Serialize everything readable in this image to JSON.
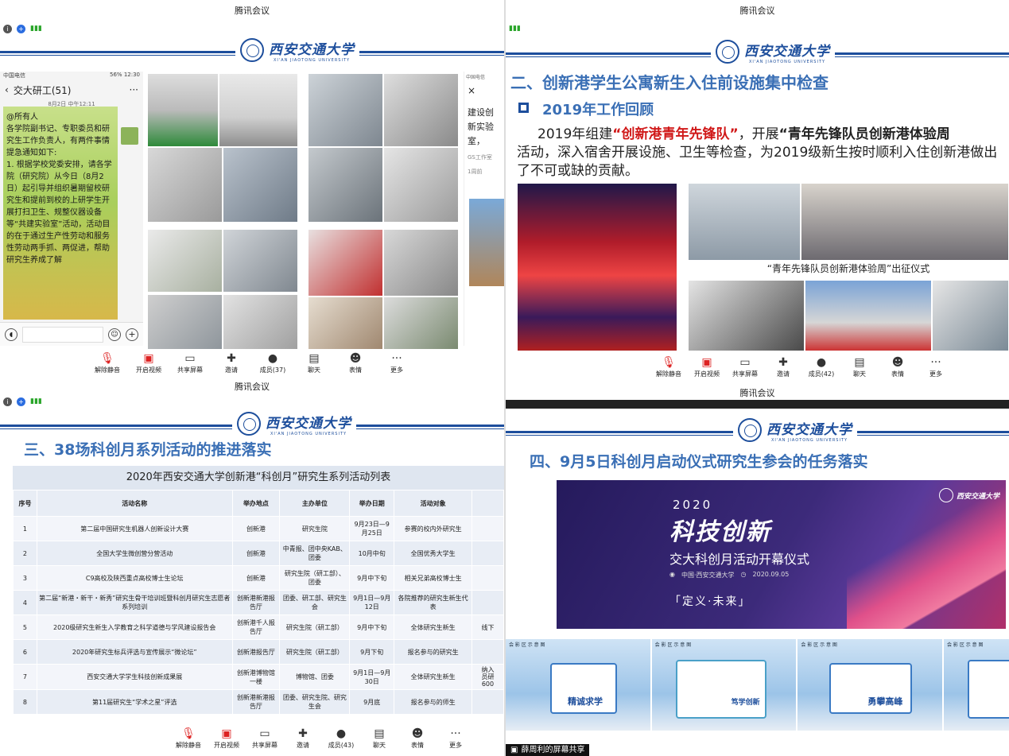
{
  "app_title": "腾讯会议",
  "toolbar": {
    "unmute": "解除静音",
    "video": "开启视频",
    "share": "共享屏幕",
    "invite": "邀请",
    "chat": "聊天",
    "reactions": "表情",
    "more": "更多"
  },
  "p1": {
    "members": "成员(37)"
  },
  "p2": {
    "members": "成员(42)"
  },
  "p3": {
    "members": "成员(43)"
  },
  "university": {
    "cn": "西安交通大学",
    "en": "XI'AN JIAOTONG UNIVERSITY"
  },
  "chat": {
    "status_carrier": "中国电信",
    "status_battery": "56%",
    "status_time": "12:30",
    "title": "交大研工(51)",
    "timestamp": "8月2日 中午12:11",
    "message": "@所有人\n各学院副书记、专职委员和研究生工作负责人，有两件事情提急通知如下:\n1. 根据学校党委安排，请各学院（研究院）从今日（8月2日）起引导并组织暑期留校研究生和提前到校的上研学生开展打扫卫生、规整仪器设备等“共建实验室”活动，活动目的在于通过生产性劳动和服务性劳动两手抓、两促进，帮助研究生养成了解",
    "side_carrier": "中国电信",
    "side_title": "建设创新实验室，",
    "side_source": "GS工作室",
    "side_time": "1周前"
  },
  "p2_slide": {
    "heading": "二、创新港学生公寓新生入住前设施集中检查",
    "subheading": "2019年工作回顾",
    "body_pre": "2019年组建",
    "body_red": "“创新港青年先锋队”",
    "body_mid": "，开展",
    "body_bold": "“青年先锋队员创新港体验周",
    "body_rest": "活动，深入宿舍开展设施、卫生等检查，为2019级新生按时顺利入住创新港做出了不可或缺的贡献。",
    "photo_caption": "“青年先锋队员创新港体验周”出征仪式"
  },
  "p3_slide": {
    "heading": "三、38场科创月系列活动的推进落实",
    "table_title": "2020年西安交通大学创新港“科创月”研究生系列活动列表",
    "columns": [
      "序号",
      "活动名称",
      "举办地点",
      "主办单位",
      "举办日期",
      "活动对象"
    ],
    "rows": [
      [
        "1",
        "第二届中国研究生机器人创新设计大赛",
        "创新港",
        "研究生院",
        "9月23日—9月25日",
        "参赛的校内外研究生"
      ],
      [
        "2",
        "全国大学生微创营分营活动",
        "创新港",
        "中青报、团中央KAB、团委",
        "10月中旬",
        "全国优秀大学生"
      ],
      [
        "3",
        "C9高校及陕西重点高校博士生论坛",
        "创新港",
        "研究生院（研工部）、团委",
        "9月中下旬",
        "相关兄弟高校博士生"
      ],
      [
        "4",
        "第二届“新港・新干・新秀”研究生骨干培训班暨科创月研究生志愿者系列培训",
        "创新港新港报告厅",
        "团委、研工部、研究生会",
        "9月1日—9月12日",
        "各院推荐的研究生新生代表"
      ],
      [
        "5",
        "2020级研究生新生入学教育之科学道德与学风建设报告会",
        "创新港千人报告厅",
        "研究生院（研工部）",
        "9月中下旬",
        "全体研究生新生"
      ],
      [
        "6",
        "2020年研究生标兵评选与宣传展示“微论坛”",
        "创新港报告厅",
        "研究生院（研工部）",
        "9月下旬",
        "报名参与的研究生"
      ],
      [
        "7",
        "西安交通大学学生科技创新成果展",
        "创新港博物馆一楼",
        "博物馆、团委",
        "9月1日—9月30日",
        "全体研究生新生"
      ],
      [
        "8",
        "第11届研究生“学术之星”评选",
        "创新港新港报告厅",
        "团委、研究生院、研究生会",
        "9月底",
        "报名参与的师生"
      ]
    ],
    "overflow_5": "线下",
    "overflow_7a": "纳入",
    "overflow_7b": "员研",
    "overflow_7c": "600"
  },
  "p4_slide": {
    "heading": "四、9月5日科创月启动仪式研究生参会的任务落实",
    "banner_year": "2020",
    "banner_title": "科技创新",
    "banner_subtitle": "交大科创月活动开幕仪式",
    "banner_location": "中国·西安交通大学",
    "banner_date": "2020.09.05",
    "banner_motto": "「定义·未来」",
    "zone_label_1": "会 影 区 示 意 图",
    "zone_label_2": "会 影 区 示 意 图",
    "zone_label_3": "会 影 区 示 意 图",
    "zone_label_4": "会 影 区 示 意 图",
    "zone_name_1": "精诚求学",
    "zone_name_2": "笃学创新",
    "zone_name_3": "勇攀高峰",
    "share_notice": "薛周利的屏幕共享"
  },
  "colors": {
    "brand_blue": "#1d4e9c",
    "heading_blue": "#3a6fb5",
    "accent_red": "#d01818",
    "banner_purple": "#3c2a7a"
  }
}
